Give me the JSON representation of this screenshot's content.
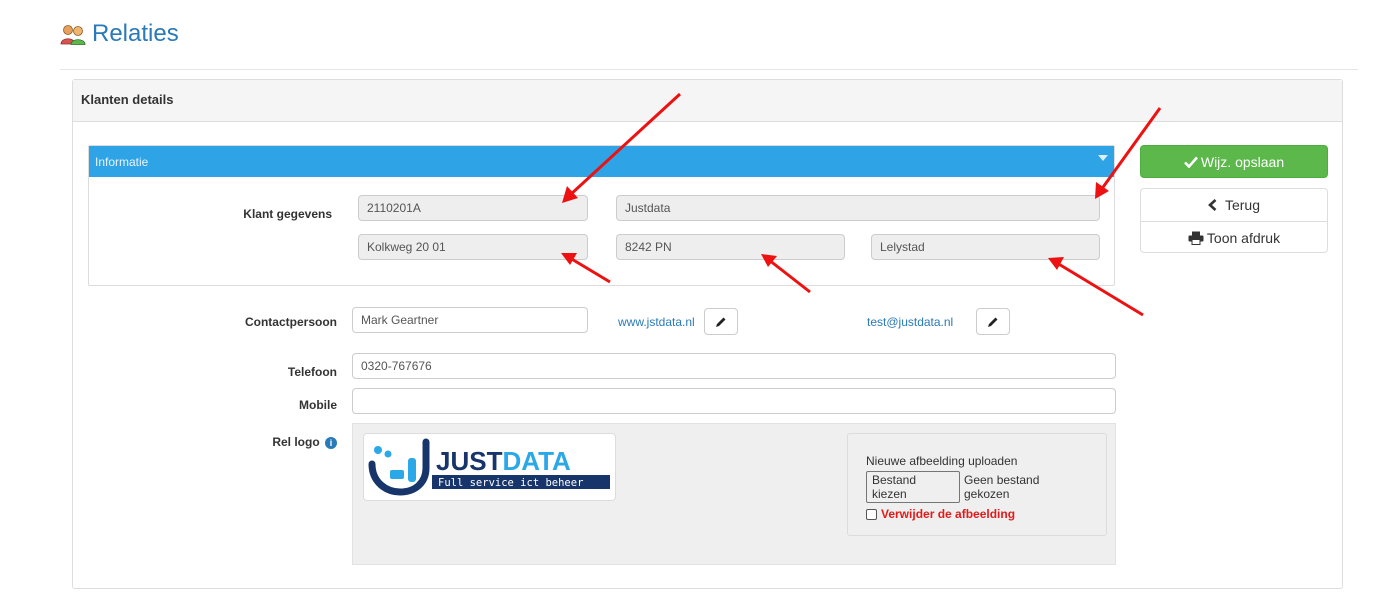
{
  "page": {
    "title": "Relaties"
  },
  "panel": {
    "title": "Klanten details"
  },
  "informatie": {
    "header": "Informatie",
    "label": "Klant gegevens",
    "klantnummer": "2110201A",
    "naam": "Justdata",
    "adres": "Kolkweg 20 01",
    "postcode": "8242 PN",
    "plaats": "Lelystad"
  },
  "contact": {
    "label": "Contactpersoon",
    "value": "Mark Geartner",
    "website": "www.jstdata.nl",
    "email": "test@justdata.nl"
  },
  "telefoon": {
    "label": "Telefoon",
    "value": "0320-767676"
  },
  "mobile": {
    "label": "Mobile",
    "value": ""
  },
  "logo": {
    "label": "Rel logo",
    "brand_main": "JUST",
    "brand_accent": "DATA",
    "tagline": "Full service ict beheer",
    "upload_label": "Nieuwe afbeelding uploaden",
    "file_button": "Bestand kiezen",
    "file_status": "Geen bestand gekozen",
    "remove_label": "Verwijder de afbeelding"
  },
  "actions": {
    "save": "Wijz. opslaan",
    "back": "Terug",
    "print": "Toon afdruk"
  },
  "colors": {
    "header_blue": "#2ea3e6",
    "save_green": "#5cb84b",
    "link_blue": "#2a7ab8",
    "remove_red": "#e31a1a",
    "annotation_red": "#ee1111"
  }
}
